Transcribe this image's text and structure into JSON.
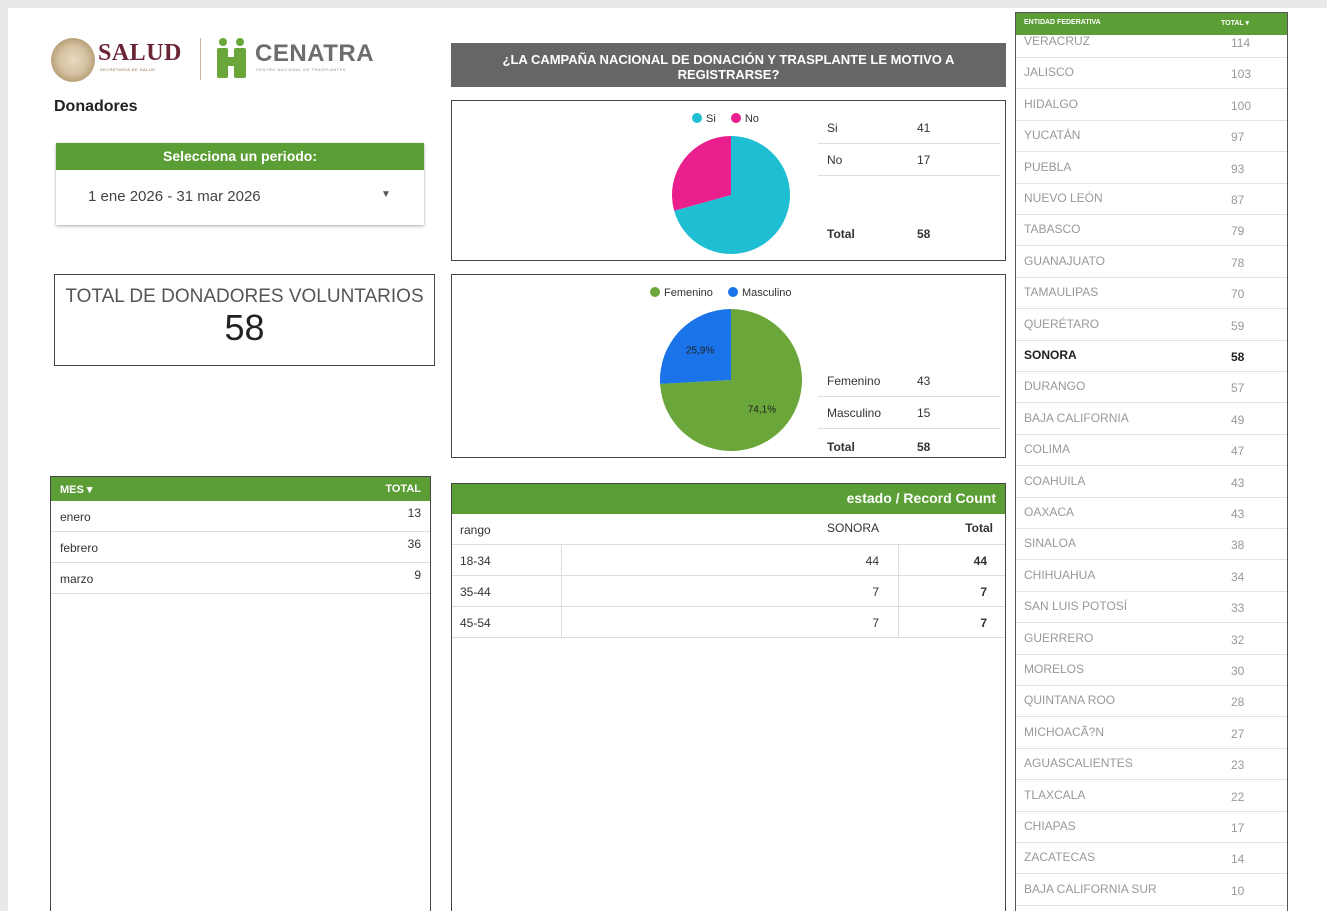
{
  "header": {
    "salud_logo": "SALUD",
    "salud_subtitle": "SECRETARÍA DE SALUD",
    "cenatra_logo": "CENATRA",
    "cenatra_subtitle": "CENTRO NACIONAL DE TRASPLANTES",
    "page_title": "Donadores"
  },
  "period": {
    "label": "Selecciona un periodo:",
    "value": "1 ene 2026 - 31 mar 2026"
  },
  "total_box": {
    "label": "TOTAL DE DONADORES VOLUNTARIOS",
    "value": "58"
  },
  "month_table": {
    "col_month": "MES",
    "col_total": "TOTAL",
    "sort_icon": "sort-desc-icon",
    "rows": [
      {
        "month": "enero",
        "total": "13"
      },
      {
        "month": "febrero",
        "total": "36"
      },
      {
        "month": "marzo",
        "total": "9"
      }
    ]
  },
  "question": {
    "title": "¿LA CAMPAÑA NACIONAL DE DONACIÓN Y TRASPLANTE LE MOTIVO A REGISTRARSE?"
  },
  "campaign_chart": {
    "legend": [
      {
        "label": "Si",
        "color": "#1fbed3"
      },
      {
        "label": "No",
        "color": "#ea1e8c"
      }
    ],
    "table": [
      {
        "label": "Si",
        "value": "41"
      },
      {
        "label": "No",
        "value": "17"
      }
    ],
    "total_label": "Total",
    "total_value": "58"
  },
  "gender_chart": {
    "legend": [
      {
        "label": "Femenino",
        "color": "#6aa63a"
      },
      {
        "label": "Masculino",
        "color": "#1a73e8"
      }
    ],
    "pct_labels": {
      "femenino": "74,1%",
      "masculino": "25,9%"
    },
    "table": [
      {
        "label": "Femenino",
        "value": "43"
      },
      {
        "label": "Masculino",
        "value": "15"
      }
    ],
    "total_label": "Total",
    "total_value": "58"
  },
  "chart_data": [
    {
      "type": "pie",
      "categories": [
        "Si",
        "No"
      ],
      "values": [
        41,
        17
      ],
      "colors": [
        "#1fbed3",
        "#ea1e8c"
      ],
      "legend": "top"
    },
    {
      "type": "pie",
      "categories": [
        "Femenino",
        "Masculino"
      ],
      "values": [
        43,
        15
      ],
      "percent_labels": [
        "74,1%",
        "25,9%"
      ],
      "colors": [
        "#6aa63a",
        "#1a73e8"
      ],
      "legend": "top"
    }
  ],
  "range_table": {
    "title": "estado / Record Count",
    "col_range": "rango",
    "col_state": "SONORA",
    "col_total": "Total",
    "rows": [
      {
        "range": "18-34",
        "state": "44",
        "total": "44"
      },
      {
        "range": "35-44",
        "state": "7",
        "total": "7"
      },
      {
        "range": "45-54",
        "state": "7",
        "total": "7"
      }
    ]
  },
  "state_table": {
    "col_state": "ENTIDAD FEDERATIVA",
    "col_total": "TOTAL",
    "sort_icon": "sort-desc-icon",
    "rows": [
      {
        "state": "VERACRUZ",
        "total": "114"
      },
      {
        "state": "JALISCO",
        "total": "103"
      },
      {
        "state": "HIDALGO",
        "total": "100"
      },
      {
        "state": "YUCATÁN",
        "total": "97"
      },
      {
        "state": "PUEBLA",
        "total": "93"
      },
      {
        "state": "NUEVO LEÓN",
        "total": "87"
      },
      {
        "state": "TABASCO",
        "total": "79"
      },
      {
        "state": "GUANAJUATO",
        "total": "78"
      },
      {
        "state": "TAMAULIPAS",
        "total": "70"
      },
      {
        "state": "QUERÉTARO",
        "total": "59"
      },
      {
        "state": "SONORA",
        "total": "58",
        "highlight": true
      },
      {
        "state": "DURANGO",
        "total": "57"
      },
      {
        "state": "BAJA CALIFORNIA",
        "total": "49"
      },
      {
        "state": "COLIMA",
        "total": "47"
      },
      {
        "state": "COAHUILA",
        "total": "43"
      },
      {
        "state": "OAXACA",
        "total": "43"
      },
      {
        "state": "SINALOA",
        "total": "38"
      },
      {
        "state": "CHIHUAHUA",
        "total": "34"
      },
      {
        "state": "SAN LUIS POTOSÍ",
        "total": "33"
      },
      {
        "state": "GUERRERO",
        "total": "32"
      },
      {
        "state": "MORELOS",
        "total": "30"
      },
      {
        "state": "QUINTANA ROO",
        "total": "28"
      },
      {
        "state": "MICHOACÃ?N",
        "total": "27"
      },
      {
        "state": "AGUASCALIENTES",
        "total": "23"
      },
      {
        "state": "TLAXCALA",
        "total": "22"
      },
      {
        "state": "CHIAPAS",
        "total": "17"
      },
      {
        "state": "ZACATECAS",
        "total": "14"
      },
      {
        "state": "BAJA CALIFORNIA SUR",
        "total": "10"
      }
    ]
  }
}
